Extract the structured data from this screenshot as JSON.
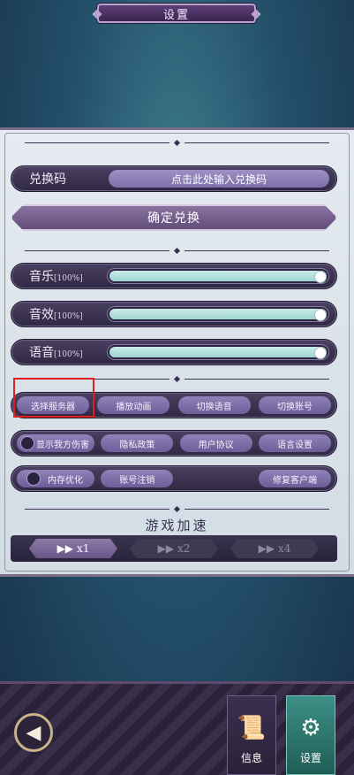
{
  "header": {
    "title": "设置"
  },
  "redeem": {
    "label": "兑换码",
    "placeholder": "点击此处输入兑换码",
    "confirm_label": "确定兑换"
  },
  "audio": [
    {
      "label": "音乐",
      "percent_text": "[100%]",
      "value": 1.0
    },
    {
      "label": "音效",
      "percent_text": "[100%]",
      "value": 1.0
    },
    {
      "label": "语音",
      "percent_text": "[100%]",
      "value": 1.0
    }
  ],
  "buttons_row1": [
    "选择服务器",
    "播放动画",
    "切换语音",
    "切换账号"
  ],
  "buttons_row2": {
    "toggle_label": "显示我方伤害",
    "items": [
      "隐私政策",
      "用户协议",
      "语言设置"
    ]
  },
  "buttons_row3": {
    "toggle_label": "内存优化",
    "items": [
      "账号注销",
      "修复客户端"
    ]
  },
  "speed": {
    "title": "游戏加速",
    "options": [
      {
        "icon": "▶▶",
        "label": "x1",
        "active": true
      },
      {
        "icon": "▶▶",
        "label": "x2",
        "active": false
      },
      {
        "icon": "▶▶",
        "label": "x4",
        "active": false
      }
    ]
  },
  "bottom": {
    "back_icon": "back-arrow-icon",
    "tabs": [
      {
        "label": "信息",
        "icon": "scroll-icon"
      },
      {
        "label": "设置",
        "icon": "gear-icon"
      }
    ]
  },
  "colors": {
    "highlight": "#e02020",
    "active_tab": "#3d8f86"
  }
}
